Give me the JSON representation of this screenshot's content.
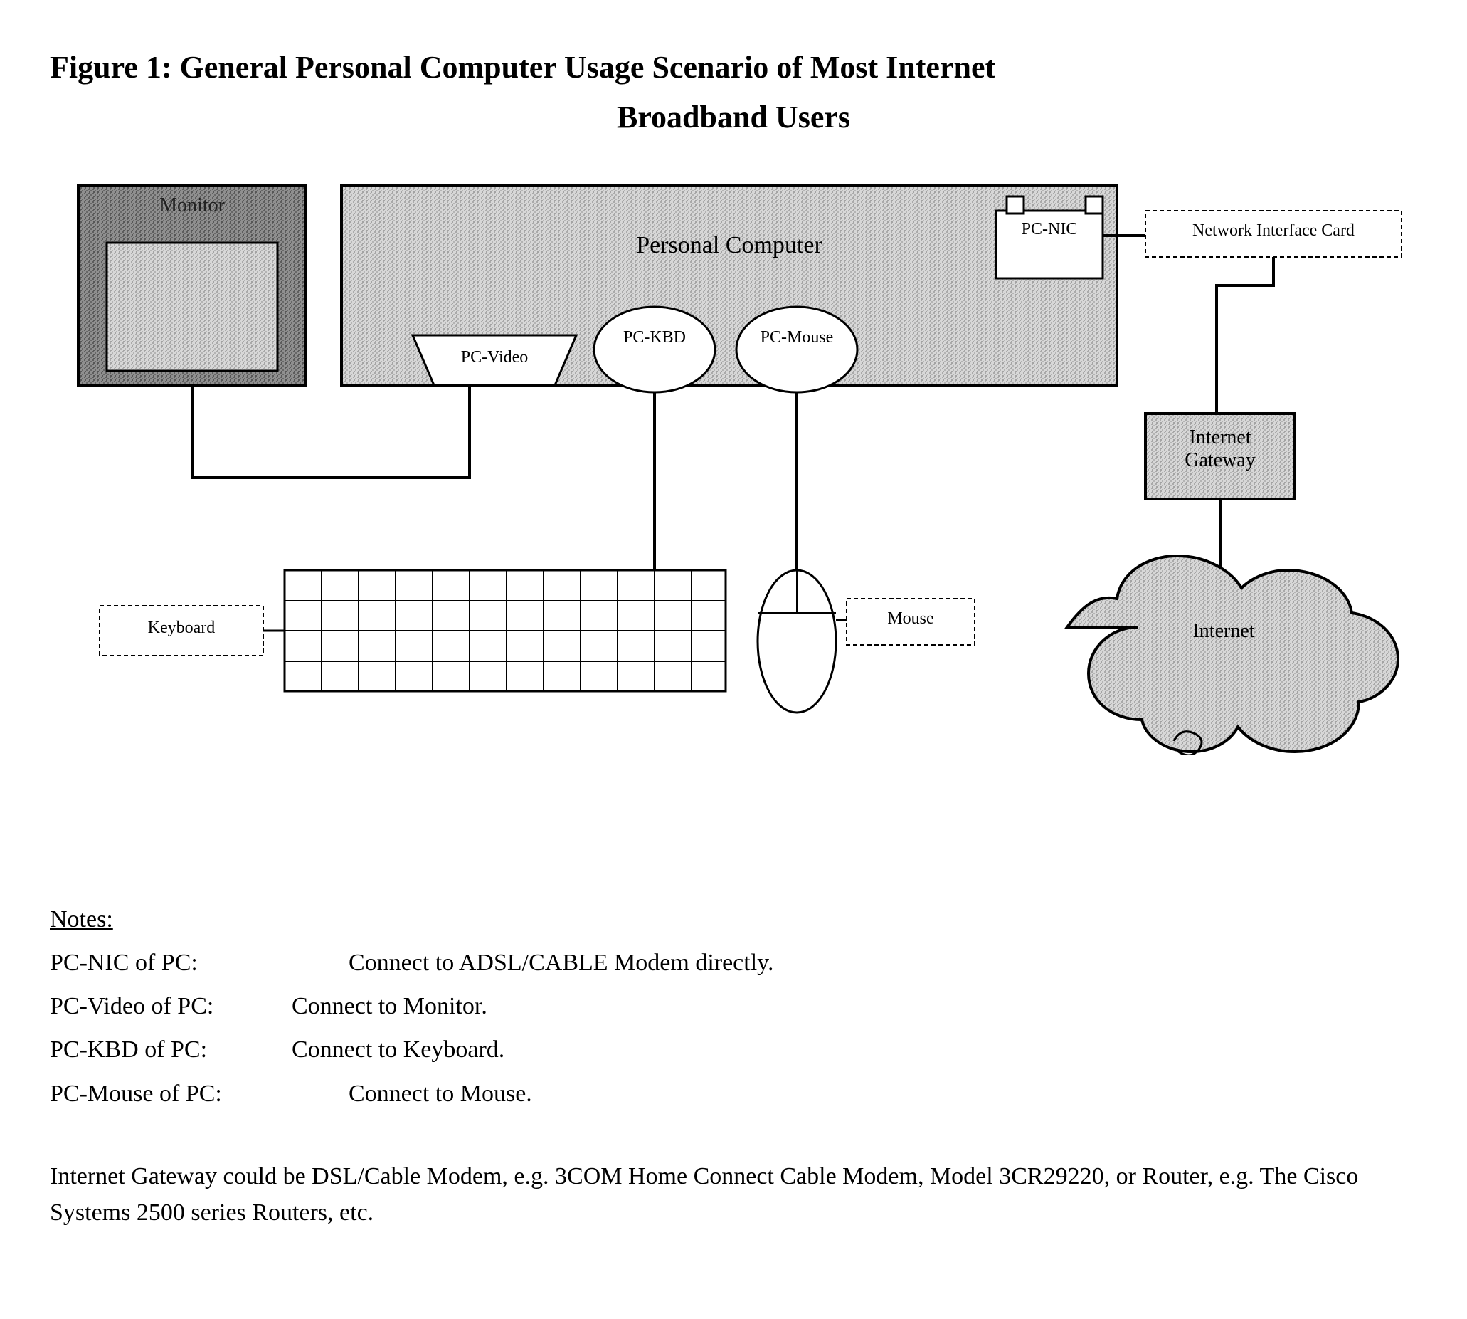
{
  "title_line1": "Figure 1:  General Personal Computer Usage Scenario of Most Internet",
  "title_line2": "Broadband Users",
  "labels": {
    "monitor": "Monitor",
    "pc": "Personal Computer",
    "pc_nic": "PC-NIC",
    "nic_card": "Network Interface Card",
    "pc_video": "PC-Video",
    "pc_kbd": "PC-KBD",
    "pc_mouse_port": "PC-Mouse",
    "gateway_l1": "Internet",
    "gateway_l2": "Gateway",
    "keyboard": "Keyboard",
    "mouse": "Mouse",
    "internet": "Internet"
  },
  "notes": {
    "header": "Notes:",
    "rows": [
      {
        "key": "PC-NIC of PC:",
        "val": "Connect to ADSL/CABLE Modem directly.",
        "wide": true
      },
      {
        "key": "PC-Video of PC:",
        "val": "Connect to Monitor."
      },
      {
        "key": "PC-KBD of PC:",
        "val": "Connect to Keyboard."
      },
      {
        "key": "PC-Mouse of PC:",
        "val": "Connect to Mouse.",
        "wide": true
      }
    ]
  },
  "footer": "Internet Gateway could be DSL/Cable Modem, e.g. 3COM Home Connect Cable Modem, Model 3CR29220, or Router, e.g. The Cisco Systems 2500 series Routers, etc."
}
